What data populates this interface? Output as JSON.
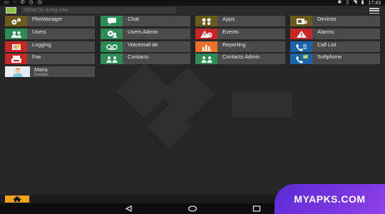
{
  "status_bar": {
    "time": "17:43"
  },
  "top_bar": {
    "status_placeholder": "What I'm doing now..."
  },
  "tiles": {
    "col1": [
      {
        "label": "PbxManager",
        "icon": "gears-icon",
        "color": "#6b5a1e"
      },
      {
        "label": "Users",
        "icon": "users-icon",
        "color": "#2e8b57"
      },
      {
        "label": "Logging",
        "icon": "logging-icon",
        "color": "#c62828"
      },
      {
        "label": "Fax",
        "icon": "fax-icon",
        "color": "#c62828"
      }
    ],
    "col2": [
      {
        "label": "Chat",
        "icon": "chat-icon",
        "color": "#2e8b57"
      },
      {
        "label": "Users Admin",
        "icon": "users-admin-icon",
        "color": "#2e8b57"
      },
      {
        "label": "Voicemail de",
        "icon": "voicemail-icon",
        "color": "#2e8b57"
      },
      {
        "label": "Contacts",
        "icon": "contacts-icon",
        "color": "#2e8b57"
      }
    ],
    "col3": [
      {
        "label": "Apps",
        "icon": "apps-icon",
        "color": "#6b5a1e"
      },
      {
        "label": "Events",
        "icon": "events-icon",
        "color": "#c62828"
      },
      {
        "label": "Reporting",
        "icon": "reporting-icon",
        "color": "#e8712b"
      },
      {
        "label": "Contacts Admin",
        "icon": "contacts-admin-icon",
        "color": "#2e8b57"
      }
    ],
    "col4": [
      {
        "label": "Devices",
        "icon": "devices-icon",
        "color": "#6b5a1e"
      },
      {
        "label": "Alarms",
        "icon": "alarm-icon",
        "color": "#c62828"
      },
      {
        "label": "Call List",
        "icon": "call-list-icon",
        "color": "#1e63a8"
      },
      {
        "label": "Softphone",
        "icon": "softphone-icon",
        "color": "#1e63a8"
      }
    ]
  },
  "contact": {
    "name": "Maria",
    "status": "Available"
  },
  "badge": {
    "text": "MYAPKS.COM"
  }
}
